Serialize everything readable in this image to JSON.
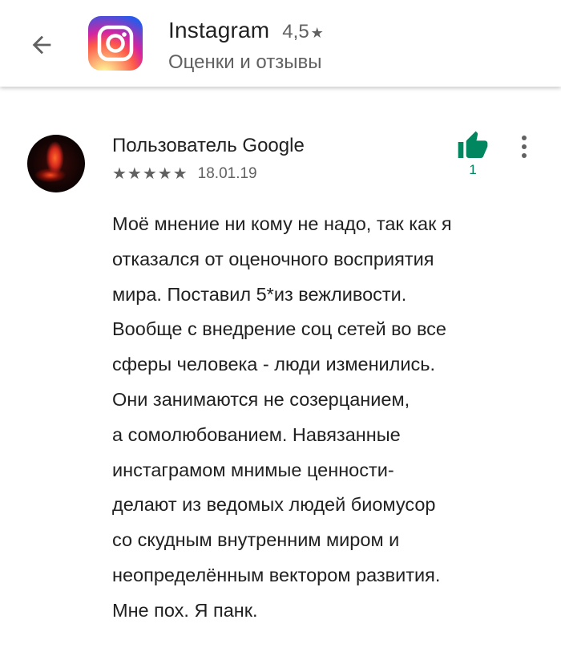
{
  "header": {
    "app_name": "Instagram",
    "rating": "4,5",
    "rating_star": "★",
    "subtitle": "Оценки и отзывы",
    "back_icon": "arrow-back-icon",
    "app_icon": "instagram-logo-icon"
  },
  "review": {
    "author": "Пользователь Google",
    "stars": "★★★★★",
    "rating_value": 5,
    "date": "18.01.19",
    "likes": "1",
    "like_icon": "thumb-up-icon",
    "more_icon": "more-vert-icon",
    "avatar_icon": "user-avatar",
    "body_lines": [
      "Моё мнение ни кому не надо, так как я",
      "отказался от оценочного восприятия",
      "мира. Поставил 5*из вежливости.",
      "Вообще с внедрение соц сетей во все",
      "сферы человека - люди изменились.",
      "Они занимаются не созерцанием,",
      "а сомолюбованием. Навязанные",
      "инстаграмом мнимые ценности-",
      "делают из ведомых людей биомусор",
      "со скудным внутренним миром и",
      "неопределённым вектором развития.",
      "Мне пох. Я панк."
    ]
  },
  "colors": {
    "accent_green": "#01875f",
    "text_primary": "#212121",
    "text_secondary": "#616161"
  }
}
